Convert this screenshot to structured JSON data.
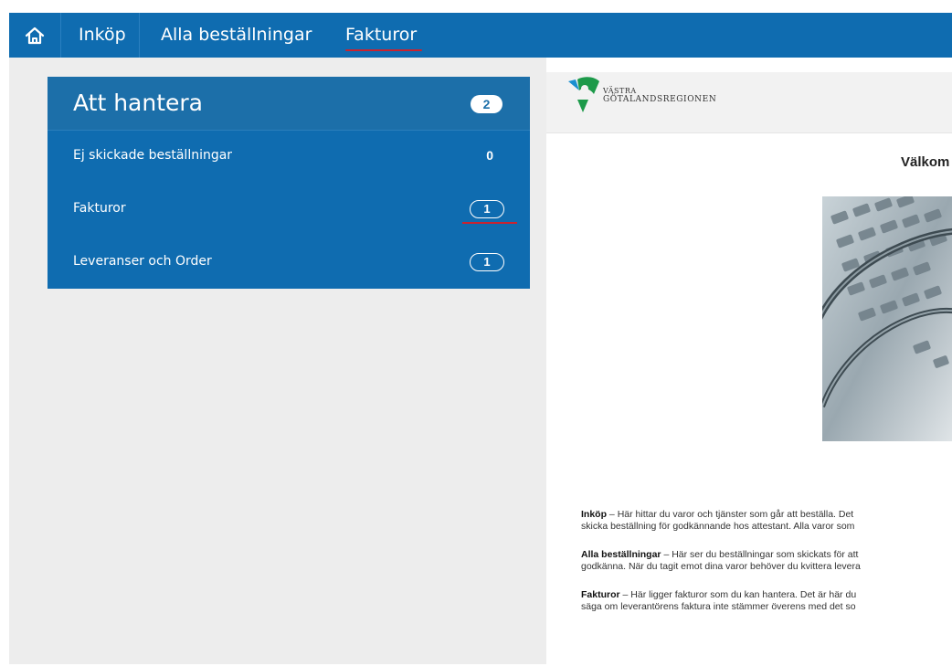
{
  "nav": {
    "items": [
      {
        "label": "Inköp"
      },
      {
        "label": "Alla beställningar"
      },
      {
        "label": "Fakturor"
      }
    ]
  },
  "todo": {
    "title": "Att hantera",
    "total": "2",
    "rows": [
      {
        "label": "Ej skickade beställningar",
        "count": "0"
      },
      {
        "label": "Fakturor",
        "count": "1"
      },
      {
        "label": "Leveranser och Order",
        "count": "1"
      }
    ]
  },
  "brand": {
    "line1": "VÄSTRA",
    "line2": "GÖTALANDSREGIONEN"
  },
  "welcome": {
    "title": "Välkom"
  },
  "info": [
    {
      "term": "Inköp",
      "sep": " – ",
      "line1": "Här hittar du varor och tjänster som går att beställa. Det",
      "line2": "skicka beställning för godkännande hos attestant. Alla varor som"
    },
    {
      "term": "Alla beställningar",
      "sep": " – ",
      "line1": "Här ser du beställningar som skickats för att",
      "line2": "godkänna. När du tagit emot dina varor behöver du kvittera levera"
    },
    {
      "term": "Fakturor",
      "sep": " – ",
      "line1": "Här ligger fakturor som du kan hantera. Det är här du",
      "line2": "säga om leverantörens faktura inte stämmer överens med det so"
    }
  ],
  "colors": {
    "brand_blue": "#0f6cb0",
    "accent_red": "#c9232f",
    "panel_gray": "#ededed"
  }
}
